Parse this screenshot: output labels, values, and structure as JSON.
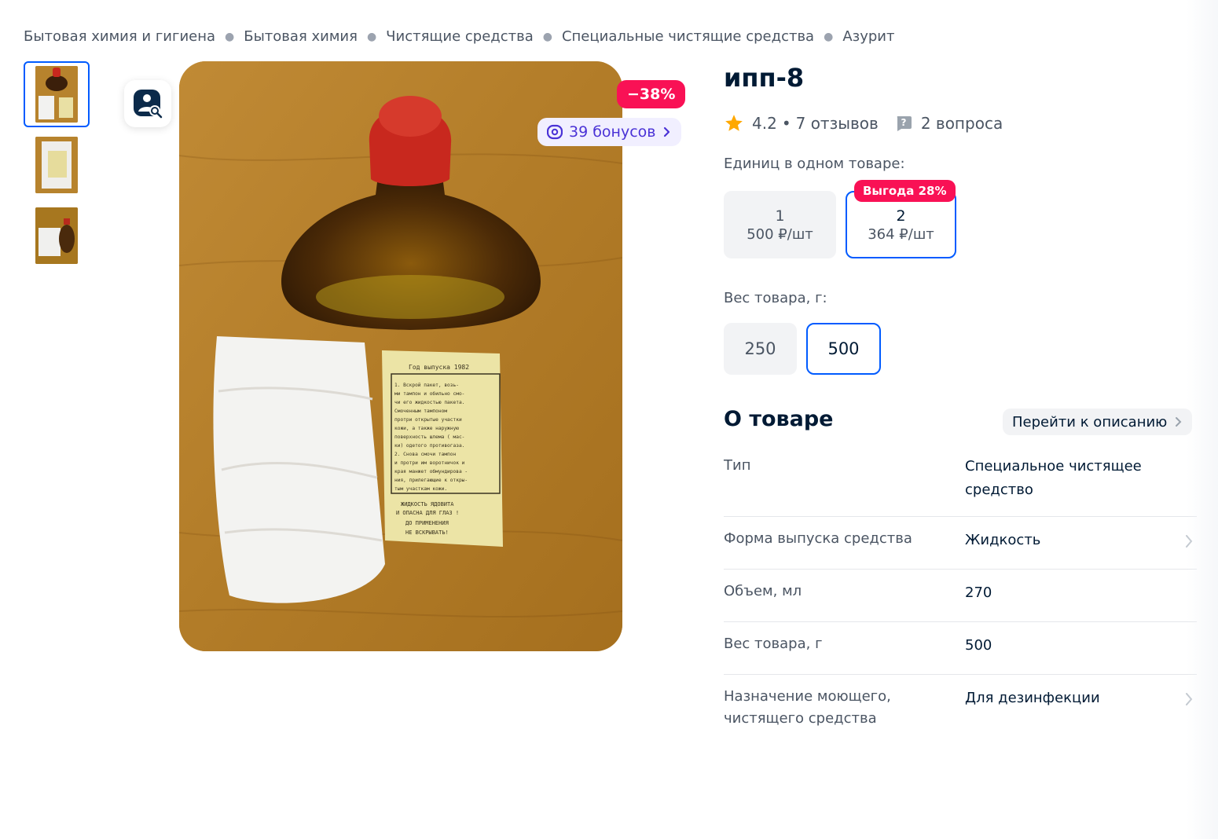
{
  "breadcrumbs": [
    "Бытовая химия и гигиена",
    "Бытовая химия",
    "Чистящие средства",
    "Специальные чистящие средства",
    "Азурит"
  ],
  "product": {
    "title": "ипп-8",
    "rating": "4.2",
    "reviews": "7 отзывов",
    "questions": "2 вопроса",
    "rating_separator": "•"
  },
  "badges": {
    "discount": "−38%",
    "bonus": "39 бонусов"
  },
  "units": {
    "label": "Единиц в одном товаре:",
    "options": [
      {
        "count": "1",
        "price": "500 ₽/шт",
        "selected": false
      },
      {
        "count": "2",
        "price": "364 ₽/шт",
        "selected": true,
        "promo": "Выгода 28%"
      }
    ]
  },
  "weight": {
    "label": "Вес товара, г:",
    "options": [
      {
        "value": "250",
        "selected": false
      },
      {
        "value": "500",
        "selected": true
      }
    ]
  },
  "about": {
    "title": "О товаре",
    "link": "Перейти к описанию",
    "specs": [
      {
        "key": "Тип",
        "value": "Специальное чистящее средство",
        "link": false
      },
      {
        "key": "Форма выпуска средства",
        "value": "Жидкость",
        "link": true
      },
      {
        "key": "Объем, мл",
        "value": "270",
        "link": false
      },
      {
        "key": "Вес товара, г",
        "value": "500",
        "link": false
      },
      {
        "key": "Назначение моющего, чистящего средства",
        "value": "Для дезинфекции",
        "link": true
      }
    ]
  },
  "photo": {
    "leaflet_lines": [
      "Год выпуска 1982",
      "1. Вскрой пакет, возь-",
      "ми тампон и обильно смо-",
      "чи его жидкостью пакета.",
      "Смоченным тампоном",
      "протри открытые участки",
      "кожи, а также наружную",
      "поверхность шлема ( мас-",
      "ки) одетого противогаза.",
      "2. Снова смочи тампон",
      "и протри им воротничок и",
      "края манжет обмундирова -",
      "ния, прилегающие к откры-",
      "тым участкам кожи."
    ],
    "leaflet_warning": [
      "ЖИДКОСТЬ ЯДОВИТА",
      "И ОПАСНА ДЛЯ ГЛАЗ !",
      "ДО ПРИМЕНЕНИЯ",
      "НЕ ВСКРЫВАТЬ!"
    ]
  },
  "colors": {
    "accent": "#005bff",
    "promo": "#f91155",
    "bonus_text": "#4a32d6",
    "star": "#ffa800"
  }
}
